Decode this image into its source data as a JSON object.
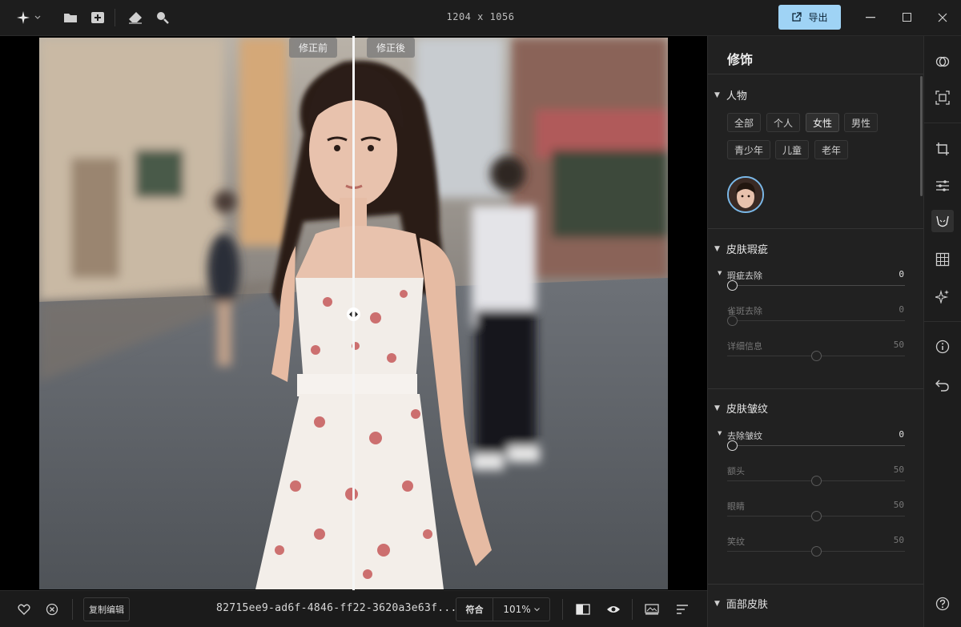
{
  "topbar": {
    "dimensions": "1204 x 1056",
    "export_label": "导出",
    "icons": [
      "sparkle-menu-icon",
      "folder-icon",
      "add-image-icon",
      "eraser-icon",
      "magnify-icon"
    ]
  },
  "canvas": {
    "before_label": "修正前",
    "after_label": "修正後",
    "split_position_fraction": 0.5
  },
  "bottombar": {
    "copy_edit_label": "复制编辑",
    "filename": "82715ee9-ad6f-4846-ff22-3620a3e63f...",
    "fit_label": "符合",
    "zoom_label": "101%"
  },
  "panel": {
    "title": "修饰",
    "person_section": {
      "title": "人物",
      "chips": [
        "全部",
        "个人",
        "女性",
        "男性",
        "青少年",
        "儿童",
        "老年"
      ],
      "active_chip": "女性"
    },
    "blemish_section": {
      "title": "皮肤瑕疵",
      "sliders": [
        {
          "label": "瑕疵去除",
          "value": "0",
          "fraction": 0.0,
          "enabled": true
        },
        {
          "label": "雀斑去除",
          "value": "0",
          "fraction": 0.0,
          "enabled": false
        },
        {
          "label": "详细信息",
          "value": "50",
          "fraction": 0.5,
          "enabled": false
        }
      ]
    },
    "wrinkle_section": {
      "title": "皮肤皱纹",
      "sliders": [
        {
          "label": "去除皱纹",
          "value": "0",
          "fraction": 0.0,
          "enabled": true
        },
        {
          "label": "额头",
          "value": "50",
          "fraction": 0.5,
          "enabled": false
        },
        {
          "label": "眼睛",
          "value": "50",
          "fraction": 0.5,
          "enabled": false
        },
        {
          "label": "笑纹",
          "value": "50",
          "fraction": 0.5,
          "enabled": false
        }
      ]
    },
    "face_skin_section": {
      "title": "面部皮肤"
    }
  },
  "rail": {
    "icons": [
      "color-circles-icon",
      "face-frame-icon",
      "crop-icon",
      "sliders-icon",
      "retouch-face-icon",
      "grid-icon",
      "sparkles-icon",
      "info-icon",
      "undo-icon",
      "help-icon"
    ],
    "active": "retouch-face-icon"
  }
}
